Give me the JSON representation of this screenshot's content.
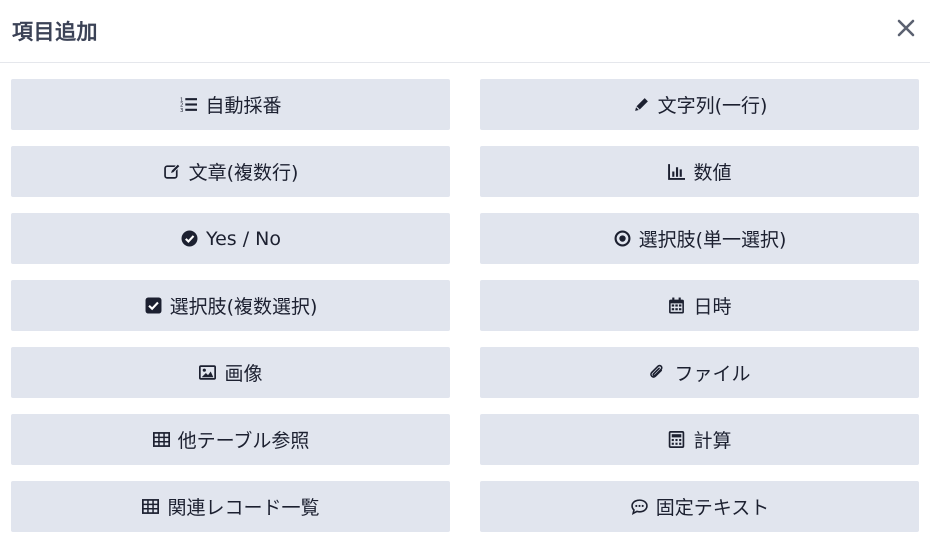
{
  "dialog": {
    "title": "項目追加",
    "close_icon": "close-icon"
  },
  "items": [
    {
      "label": "自動採番",
      "icon": "list-numbered-icon"
    },
    {
      "label": "文字列(一行)",
      "icon": "pencil-icon"
    },
    {
      "label": "文章(複数行)",
      "icon": "edit-square-icon"
    },
    {
      "label": "数値",
      "icon": "bar-chart-icon"
    },
    {
      "label": "Yes / No",
      "icon": "check-circle-icon"
    },
    {
      "label": "選択肢(単一選択)",
      "icon": "radio-dot-icon"
    },
    {
      "label": "選択肢(複数選択)",
      "icon": "check-square-icon"
    },
    {
      "label": "日時",
      "icon": "calendar-icon"
    },
    {
      "label": "画像",
      "icon": "image-icon"
    },
    {
      "label": "ファイル",
      "icon": "paperclip-icon"
    },
    {
      "label": "他テーブル参照",
      "icon": "table-icon"
    },
    {
      "label": "計算",
      "icon": "calculator-icon"
    },
    {
      "label": "関連レコード一覧",
      "icon": "table-icon"
    },
    {
      "label": "固定テキスト",
      "icon": "comment-dots-icon"
    }
  ],
  "colors": {
    "button_bg": "#e1e5ee",
    "title": "#3b4256",
    "text": "#1c2030"
  }
}
